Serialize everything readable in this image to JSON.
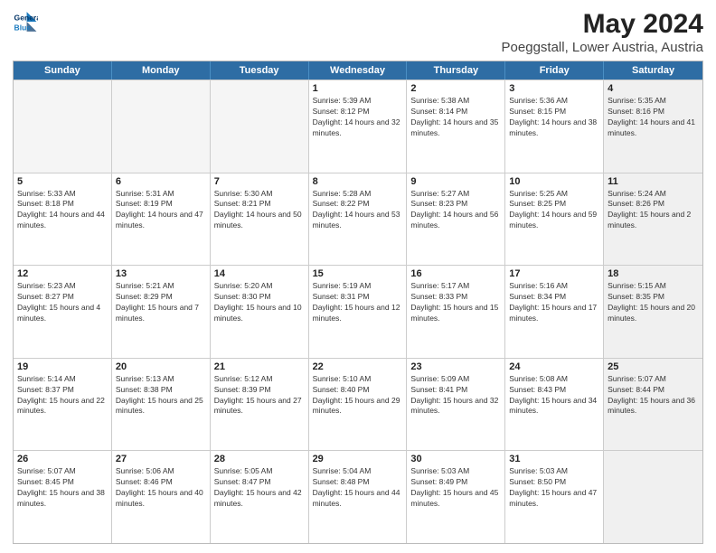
{
  "header": {
    "logo_line1": "General",
    "logo_line2": "Blue",
    "main_title": "May 2024",
    "subtitle": "Poeggstall, Lower Austria, Austria"
  },
  "days_of_week": [
    "Sunday",
    "Monday",
    "Tuesday",
    "Wednesday",
    "Thursday",
    "Friday",
    "Saturday"
  ],
  "weeks": [
    [
      {
        "day": "",
        "empty": true
      },
      {
        "day": "",
        "empty": true
      },
      {
        "day": "",
        "empty": true
      },
      {
        "day": "1",
        "sunrise": "Sunrise: 5:39 AM",
        "sunset": "Sunset: 8:12 PM",
        "daylight": "Daylight: 14 hours and 32 minutes."
      },
      {
        "day": "2",
        "sunrise": "Sunrise: 5:38 AM",
        "sunset": "Sunset: 8:14 PM",
        "daylight": "Daylight: 14 hours and 35 minutes."
      },
      {
        "day": "3",
        "sunrise": "Sunrise: 5:36 AM",
        "sunset": "Sunset: 8:15 PM",
        "daylight": "Daylight: 14 hours and 38 minutes."
      },
      {
        "day": "4",
        "sunrise": "Sunrise: 5:35 AM",
        "sunset": "Sunset: 8:16 PM",
        "daylight": "Daylight: 14 hours and 41 minutes.",
        "shaded": true
      }
    ],
    [
      {
        "day": "5",
        "sunrise": "Sunrise: 5:33 AM",
        "sunset": "Sunset: 8:18 PM",
        "daylight": "Daylight: 14 hours and 44 minutes."
      },
      {
        "day": "6",
        "sunrise": "Sunrise: 5:31 AM",
        "sunset": "Sunset: 8:19 PM",
        "daylight": "Daylight: 14 hours and 47 minutes."
      },
      {
        "day": "7",
        "sunrise": "Sunrise: 5:30 AM",
        "sunset": "Sunset: 8:21 PM",
        "daylight": "Daylight: 14 hours and 50 minutes."
      },
      {
        "day": "8",
        "sunrise": "Sunrise: 5:28 AM",
        "sunset": "Sunset: 8:22 PM",
        "daylight": "Daylight: 14 hours and 53 minutes."
      },
      {
        "day": "9",
        "sunrise": "Sunrise: 5:27 AM",
        "sunset": "Sunset: 8:23 PM",
        "daylight": "Daylight: 14 hours and 56 minutes."
      },
      {
        "day": "10",
        "sunrise": "Sunrise: 5:25 AM",
        "sunset": "Sunset: 8:25 PM",
        "daylight": "Daylight: 14 hours and 59 minutes."
      },
      {
        "day": "11",
        "sunrise": "Sunrise: 5:24 AM",
        "sunset": "Sunset: 8:26 PM",
        "daylight": "Daylight: 15 hours and 2 minutes.",
        "shaded": true
      }
    ],
    [
      {
        "day": "12",
        "sunrise": "Sunrise: 5:23 AM",
        "sunset": "Sunset: 8:27 PM",
        "daylight": "Daylight: 15 hours and 4 minutes."
      },
      {
        "day": "13",
        "sunrise": "Sunrise: 5:21 AM",
        "sunset": "Sunset: 8:29 PM",
        "daylight": "Daylight: 15 hours and 7 minutes."
      },
      {
        "day": "14",
        "sunrise": "Sunrise: 5:20 AM",
        "sunset": "Sunset: 8:30 PM",
        "daylight": "Daylight: 15 hours and 10 minutes."
      },
      {
        "day": "15",
        "sunrise": "Sunrise: 5:19 AM",
        "sunset": "Sunset: 8:31 PM",
        "daylight": "Daylight: 15 hours and 12 minutes."
      },
      {
        "day": "16",
        "sunrise": "Sunrise: 5:17 AM",
        "sunset": "Sunset: 8:33 PM",
        "daylight": "Daylight: 15 hours and 15 minutes."
      },
      {
        "day": "17",
        "sunrise": "Sunrise: 5:16 AM",
        "sunset": "Sunset: 8:34 PM",
        "daylight": "Daylight: 15 hours and 17 minutes."
      },
      {
        "day": "18",
        "sunrise": "Sunrise: 5:15 AM",
        "sunset": "Sunset: 8:35 PM",
        "daylight": "Daylight: 15 hours and 20 minutes.",
        "shaded": true
      }
    ],
    [
      {
        "day": "19",
        "sunrise": "Sunrise: 5:14 AM",
        "sunset": "Sunset: 8:37 PM",
        "daylight": "Daylight: 15 hours and 22 minutes."
      },
      {
        "day": "20",
        "sunrise": "Sunrise: 5:13 AM",
        "sunset": "Sunset: 8:38 PM",
        "daylight": "Daylight: 15 hours and 25 minutes."
      },
      {
        "day": "21",
        "sunrise": "Sunrise: 5:12 AM",
        "sunset": "Sunset: 8:39 PM",
        "daylight": "Daylight: 15 hours and 27 minutes."
      },
      {
        "day": "22",
        "sunrise": "Sunrise: 5:10 AM",
        "sunset": "Sunset: 8:40 PM",
        "daylight": "Daylight: 15 hours and 29 minutes."
      },
      {
        "day": "23",
        "sunrise": "Sunrise: 5:09 AM",
        "sunset": "Sunset: 8:41 PM",
        "daylight": "Daylight: 15 hours and 32 minutes."
      },
      {
        "day": "24",
        "sunrise": "Sunrise: 5:08 AM",
        "sunset": "Sunset: 8:43 PM",
        "daylight": "Daylight: 15 hours and 34 minutes."
      },
      {
        "day": "25",
        "sunrise": "Sunrise: 5:07 AM",
        "sunset": "Sunset: 8:44 PM",
        "daylight": "Daylight: 15 hours and 36 minutes.",
        "shaded": true
      }
    ],
    [
      {
        "day": "26",
        "sunrise": "Sunrise: 5:07 AM",
        "sunset": "Sunset: 8:45 PM",
        "daylight": "Daylight: 15 hours and 38 minutes."
      },
      {
        "day": "27",
        "sunrise": "Sunrise: 5:06 AM",
        "sunset": "Sunset: 8:46 PM",
        "daylight": "Daylight: 15 hours and 40 minutes."
      },
      {
        "day": "28",
        "sunrise": "Sunrise: 5:05 AM",
        "sunset": "Sunset: 8:47 PM",
        "daylight": "Daylight: 15 hours and 42 minutes."
      },
      {
        "day": "29",
        "sunrise": "Sunrise: 5:04 AM",
        "sunset": "Sunset: 8:48 PM",
        "daylight": "Daylight: 15 hours and 44 minutes."
      },
      {
        "day": "30",
        "sunrise": "Sunrise: 5:03 AM",
        "sunset": "Sunset: 8:49 PM",
        "daylight": "Daylight: 15 hours and 45 minutes."
      },
      {
        "day": "31",
        "sunrise": "Sunrise: 5:03 AM",
        "sunset": "Sunset: 8:50 PM",
        "daylight": "Daylight: 15 hours and 47 minutes."
      },
      {
        "day": "",
        "empty": true,
        "shaded": true
      }
    ]
  ]
}
